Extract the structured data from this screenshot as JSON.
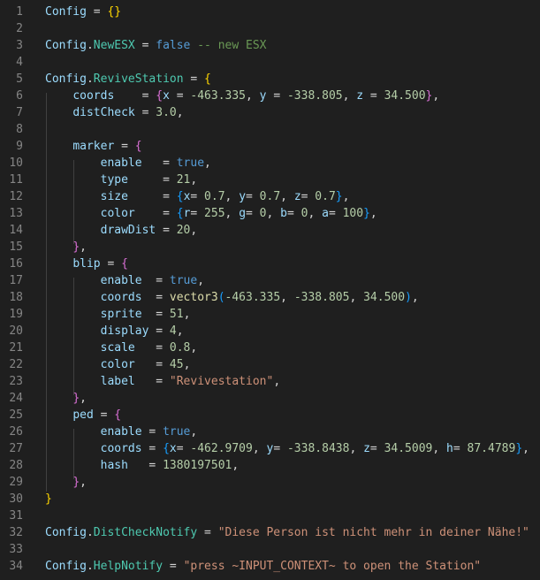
{
  "editor": {
    "language": "lua",
    "lines": [
      {
        "n": "1",
        "tokens": [
          [
            "var",
            "Config"
          ],
          [
            "op",
            " = "
          ],
          [
            "b1",
            "{}"
          ]
        ]
      },
      {
        "n": "2",
        "tokens": []
      },
      {
        "n": "3",
        "tokens": [
          [
            "var",
            "Config"
          ],
          [
            "op",
            "."
          ],
          [
            "prop",
            "NewESX"
          ],
          [
            "op",
            " = "
          ],
          [
            "kw",
            "false"
          ],
          [
            "cmt",
            " -- new ESX"
          ]
        ]
      },
      {
        "n": "4",
        "tokens": []
      },
      {
        "n": "5",
        "tokens": [
          [
            "var",
            "Config"
          ],
          [
            "op",
            "."
          ],
          [
            "prop",
            "ReviveStation"
          ],
          [
            "op",
            " = "
          ],
          [
            "b1",
            "{"
          ]
        ]
      },
      {
        "n": "6",
        "tokens": [
          [
            "op",
            "    "
          ],
          [
            "var",
            "coords"
          ],
          [
            "op",
            "    = "
          ],
          [
            "b2",
            "{"
          ],
          [
            "var",
            "x"
          ],
          [
            "op",
            " = "
          ],
          [
            "num",
            "-463.335"
          ],
          [
            "op",
            ", "
          ],
          [
            "var",
            "y"
          ],
          [
            "op",
            " = "
          ],
          [
            "num",
            "-338.805"
          ],
          [
            "op",
            ", "
          ],
          [
            "var",
            "z"
          ],
          [
            "op",
            " = "
          ],
          [
            "num",
            "34.500"
          ],
          [
            "b2",
            "}"
          ],
          [
            "op",
            ","
          ]
        ]
      },
      {
        "n": "7",
        "tokens": [
          [
            "op",
            "    "
          ],
          [
            "var",
            "distCheck"
          ],
          [
            "op",
            " = "
          ],
          [
            "num",
            "3.0"
          ],
          [
            "op",
            ","
          ]
        ]
      },
      {
        "n": "8",
        "tokens": []
      },
      {
        "n": "9",
        "tokens": [
          [
            "op",
            "    "
          ],
          [
            "var",
            "marker"
          ],
          [
            "op",
            " = "
          ],
          [
            "b2",
            "{"
          ]
        ]
      },
      {
        "n": "10",
        "tokens": [
          [
            "op",
            "        "
          ],
          [
            "var",
            "enable"
          ],
          [
            "op",
            "   = "
          ],
          [
            "kw",
            "true"
          ],
          [
            "op",
            ","
          ]
        ]
      },
      {
        "n": "11",
        "tokens": [
          [
            "op",
            "        "
          ],
          [
            "var",
            "type"
          ],
          [
            "op",
            "     = "
          ],
          [
            "num",
            "21"
          ],
          [
            "op",
            ","
          ]
        ]
      },
      {
        "n": "12",
        "tokens": [
          [
            "op",
            "        "
          ],
          [
            "var",
            "size"
          ],
          [
            "op",
            "     = "
          ],
          [
            "b3",
            "{"
          ],
          [
            "var",
            "x"
          ],
          [
            "op",
            "= "
          ],
          [
            "num",
            "0.7"
          ],
          [
            "op",
            ", "
          ],
          [
            "var",
            "y"
          ],
          [
            "op",
            "= "
          ],
          [
            "num",
            "0.7"
          ],
          [
            "op",
            ", "
          ],
          [
            "var",
            "z"
          ],
          [
            "op",
            "= "
          ],
          [
            "num",
            "0.7"
          ],
          [
            "b3",
            "}"
          ],
          [
            "op",
            ","
          ]
        ]
      },
      {
        "n": "13",
        "tokens": [
          [
            "op",
            "        "
          ],
          [
            "var",
            "color"
          ],
          [
            "op",
            "    = "
          ],
          [
            "b3",
            "{"
          ],
          [
            "var",
            "r"
          ],
          [
            "op",
            "= "
          ],
          [
            "num",
            "255"
          ],
          [
            "op",
            ", "
          ],
          [
            "var",
            "g"
          ],
          [
            "op",
            "= "
          ],
          [
            "num",
            "0"
          ],
          [
            "op",
            ", "
          ],
          [
            "var",
            "b"
          ],
          [
            "op",
            "= "
          ],
          [
            "num",
            "0"
          ],
          [
            "op",
            ", "
          ],
          [
            "var",
            "a"
          ],
          [
            "op",
            "= "
          ],
          [
            "num",
            "100"
          ],
          [
            "b3",
            "}"
          ],
          [
            "op",
            ","
          ]
        ]
      },
      {
        "n": "14",
        "tokens": [
          [
            "op",
            "        "
          ],
          [
            "var",
            "drawDist"
          ],
          [
            "op",
            " = "
          ],
          [
            "num",
            "20"
          ],
          [
            "op",
            ","
          ]
        ]
      },
      {
        "n": "15",
        "tokens": [
          [
            "op",
            "    "
          ],
          [
            "b2",
            "}"
          ],
          [
            "op",
            ","
          ]
        ]
      },
      {
        "n": "16",
        "tokens": [
          [
            "op",
            "    "
          ],
          [
            "var",
            "blip"
          ],
          [
            "op",
            " = "
          ],
          [
            "b2",
            "{"
          ]
        ]
      },
      {
        "n": "17",
        "tokens": [
          [
            "op",
            "        "
          ],
          [
            "var",
            "enable"
          ],
          [
            "op",
            "  = "
          ],
          [
            "kw",
            "true"
          ],
          [
            "op",
            ","
          ]
        ]
      },
      {
        "n": "18",
        "tokens": [
          [
            "op",
            "        "
          ],
          [
            "var",
            "coords"
          ],
          [
            "op",
            "  = "
          ],
          [
            "fn",
            "vector3"
          ],
          [
            "b3",
            "("
          ],
          [
            "num",
            "-463.335"
          ],
          [
            "op",
            ", "
          ],
          [
            "num",
            "-338.805"
          ],
          [
            "op",
            ", "
          ],
          [
            "num",
            "34.500"
          ],
          [
            "b3",
            ")"
          ],
          [
            "op",
            ","
          ]
        ]
      },
      {
        "n": "19",
        "tokens": [
          [
            "op",
            "        "
          ],
          [
            "var",
            "sprite"
          ],
          [
            "op",
            "  = "
          ],
          [
            "num",
            "51"
          ],
          [
            "op",
            ","
          ]
        ]
      },
      {
        "n": "20",
        "tokens": [
          [
            "op",
            "        "
          ],
          [
            "var",
            "display"
          ],
          [
            "op",
            " = "
          ],
          [
            "num",
            "4"
          ],
          [
            "op",
            ","
          ]
        ]
      },
      {
        "n": "21",
        "tokens": [
          [
            "op",
            "        "
          ],
          [
            "var",
            "scale"
          ],
          [
            "op",
            "   = "
          ],
          [
            "num",
            "0.8"
          ],
          [
            "op",
            ","
          ]
        ]
      },
      {
        "n": "22",
        "tokens": [
          [
            "op",
            "        "
          ],
          [
            "var",
            "color"
          ],
          [
            "op",
            "   = "
          ],
          [
            "num",
            "45"
          ],
          [
            "op",
            ","
          ]
        ]
      },
      {
        "n": "23",
        "tokens": [
          [
            "op",
            "        "
          ],
          [
            "var",
            "label"
          ],
          [
            "op",
            "   = "
          ],
          [
            "str",
            "\"Revivestation\""
          ],
          [
            "op",
            ","
          ]
        ]
      },
      {
        "n": "24",
        "tokens": [
          [
            "op",
            "    "
          ],
          [
            "b2",
            "}"
          ],
          [
            "op",
            ","
          ]
        ]
      },
      {
        "n": "25",
        "tokens": [
          [
            "op",
            "    "
          ],
          [
            "var",
            "ped"
          ],
          [
            "op",
            " = "
          ],
          [
            "b2",
            "{"
          ]
        ]
      },
      {
        "n": "26",
        "tokens": [
          [
            "op",
            "        "
          ],
          [
            "var",
            "enable"
          ],
          [
            "op",
            " = "
          ],
          [
            "kw",
            "true"
          ],
          [
            "op",
            ","
          ]
        ]
      },
      {
        "n": "27",
        "tokens": [
          [
            "op",
            "        "
          ],
          [
            "var",
            "coords"
          ],
          [
            "op",
            " = "
          ],
          [
            "b3",
            "{"
          ],
          [
            "var",
            "x"
          ],
          [
            "op",
            "= "
          ],
          [
            "num",
            "-462.9709"
          ],
          [
            "op",
            ", "
          ],
          [
            "var",
            "y"
          ],
          [
            "op",
            "= "
          ],
          [
            "num",
            "-338.8438"
          ],
          [
            "op",
            ", "
          ],
          [
            "var",
            "z"
          ],
          [
            "op",
            "= "
          ],
          [
            "num",
            "34.5009"
          ],
          [
            "op",
            ", "
          ],
          [
            "var",
            "h"
          ],
          [
            "op",
            "= "
          ],
          [
            "num",
            "87.4789"
          ],
          [
            "b3",
            "}"
          ],
          [
            "op",
            ","
          ]
        ]
      },
      {
        "n": "28",
        "tokens": [
          [
            "op",
            "        "
          ],
          [
            "var",
            "hash"
          ],
          [
            "op",
            "   = "
          ],
          [
            "num",
            "1380197501"
          ],
          [
            "op",
            ","
          ]
        ]
      },
      {
        "n": "29",
        "tokens": [
          [
            "op",
            "    "
          ],
          [
            "b2",
            "}"
          ],
          [
            "op",
            ","
          ]
        ]
      },
      {
        "n": "30",
        "tokens": [
          [
            "b1",
            "}"
          ]
        ]
      },
      {
        "n": "31",
        "tokens": []
      },
      {
        "n": "32",
        "tokens": [
          [
            "var",
            "Config"
          ],
          [
            "op",
            "."
          ],
          [
            "prop",
            "DistCheckNotify"
          ],
          [
            "op",
            " = "
          ],
          [
            "str",
            "\"Diese Person ist nicht mehr in deiner Nähe!\""
          ]
        ]
      },
      {
        "n": "33",
        "tokens": []
      },
      {
        "n": "34",
        "tokens": [
          [
            "var",
            "Config"
          ],
          [
            "op",
            "."
          ],
          [
            "prop",
            "HelpNotify"
          ],
          [
            "op",
            " = "
          ],
          [
            "str",
            "\"press ~INPUT_CONTEXT~ to open the Station\""
          ]
        ]
      }
    ]
  }
}
